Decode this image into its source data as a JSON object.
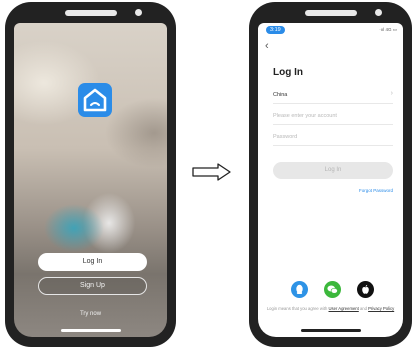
{
  "left_screen": {
    "login_label": "Log In",
    "signup_label": "Sign Up",
    "try_now_label": "Try now",
    "logo_icon": "smart-home-logo-icon"
  },
  "right_screen": {
    "status_time": "3:19",
    "status_right": "·ııl 4G ▭",
    "title": "Log In",
    "country_value": "China",
    "account_placeholder": "Please enter your account",
    "password_placeholder": "Password",
    "login_button_label": "Log In",
    "forgot_password_label": "Forgot Password",
    "agreement_prefix": "Login means that you agree with",
    "user_agreement_label": "User Agreement",
    "agreement_and": "and",
    "privacy_policy_label": "Privacy Policy",
    "social_icons": [
      "qq-icon",
      "wechat-icon",
      "apple-icon"
    ]
  },
  "colors": {
    "accent": "#2b8ce8",
    "wechat": "#3cb83c",
    "frame": "#222222"
  }
}
